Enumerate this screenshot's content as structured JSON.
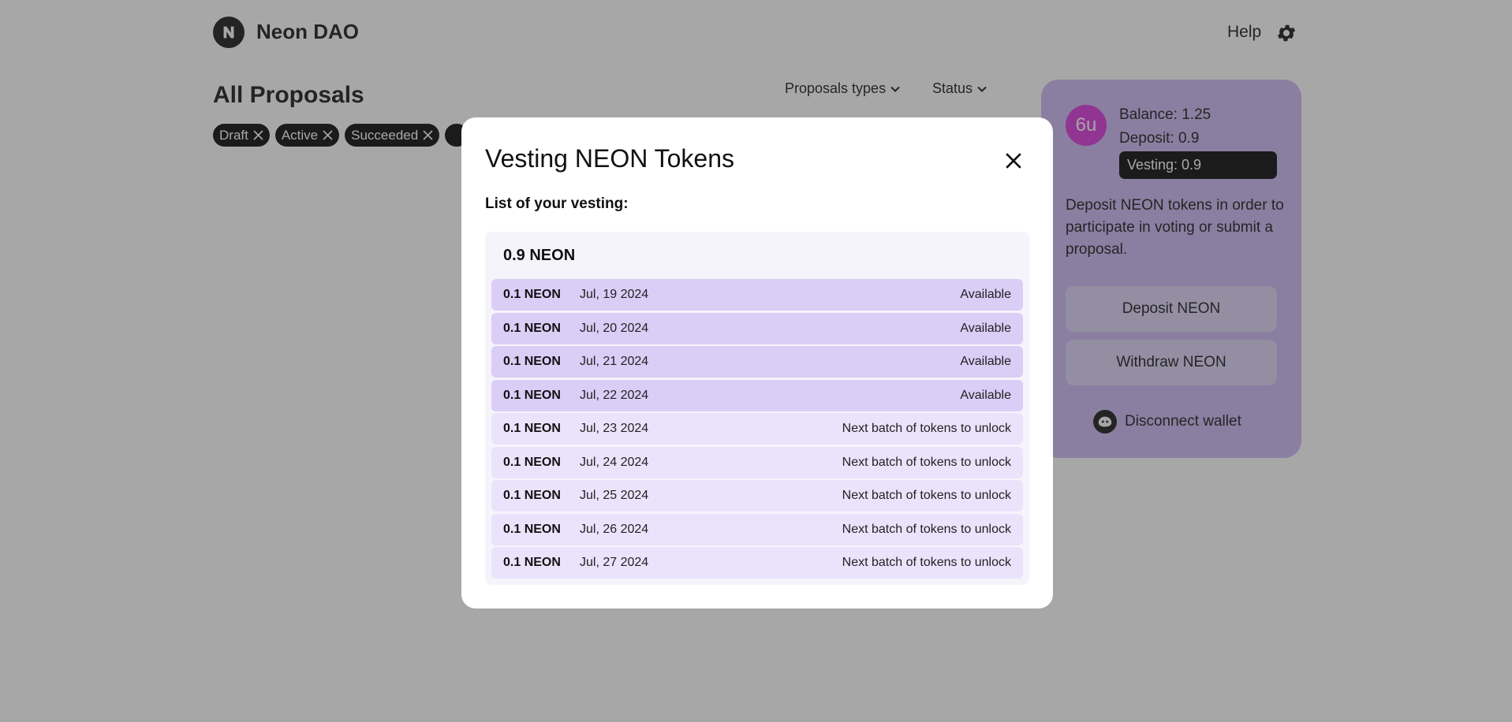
{
  "header": {
    "brand": "Neon DAO",
    "help": "Help"
  },
  "main": {
    "title": "All Proposals",
    "filters": {
      "proposal_types": "Proposals types",
      "status": "Status"
    },
    "chips": [
      "Draft",
      "Active",
      "Succeeded"
    ]
  },
  "panel": {
    "avatar": "6u",
    "balance": "Balance: 1.25",
    "deposit": "Deposit: 0.9",
    "vesting": "Vesting: 0.9",
    "description": "Deposit NEON tokens in order to participate in voting or submit a proposal.",
    "deposit_button": "Deposit NEON",
    "withdraw_button": "Withdraw NEON",
    "disconnect": "Disconnect wallet"
  },
  "modal": {
    "title": "Vesting NEON Tokens",
    "subtitle": "List of your vesting:",
    "total": "0.9 NEON",
    "rows": [
      {
        "amount": "0.1 NEON",
        "date": "Jul, 19 2024",
        "status": "Available",
        "state": "available"
      },
      {
        "amount": "0.1 NEON",
        "date": "Jul, 20 2024",
        "status": "Available",
        "state": "available"
      },
      {
        "amount": "0.1 NEON",
        "date": "Jul, 21 2024",
        "status": "Available",
        "state": "available"
      },
      {
        "amount": "0.1 NEON",
        "date": "Jul, 22 2024",
        "status": "Available",
        "state": "available"
      },
      {
        "amount": "0.1 NEON",
        "date": "Jul, 23 2024",
        "status": "Next batch of tokens to unlock",
        "state": "locked"
      },
      {
        "amount": "0.1 NEON",
        "date": "Jul, 24 2024",
        "status": "Next batch of tokens to unlock",
        "state": "locked"
      },
      {
        "amount": "0.1 NEON",
        "date": "Jul, 25 2024",
        "status": "Next batch of tokens to unlock",
        "state": "locked"
      },
      {
        "amount": "0.1 NEON",
        "date": "Jul, 26 2024",
        "status": "Next batch of tokens to unlock",
        "state": "locked"
      },
      {
        "amount": "0.1 NEON",
        "date": "Jul, 27 2024",
        "status": "Next batch of tokens to unlock",
        "state": "locked"
      }
    ]
  },
  "colors": {
    "accent": "#cbb7f4",
    "available_row": "#dacdf6",
    "locked_row": "#ebe3fc",
    "avatar": "#d731d9"
  }
}
